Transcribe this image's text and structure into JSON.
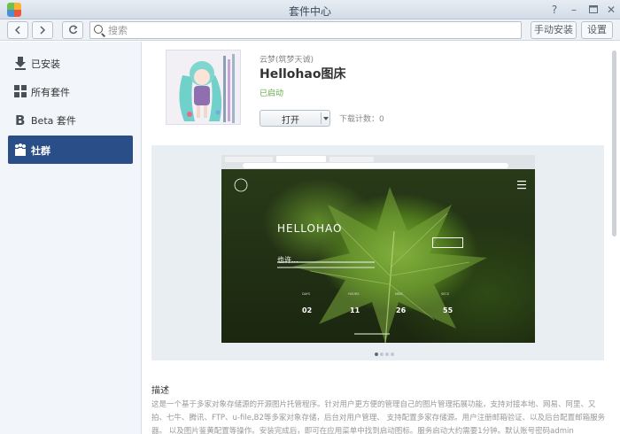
{
  "window": {
    "title": "套件中心"
  },
  "toolbar": {
    "back_icon": "chevron-left-icon",
    "forward_icon": "chevron-right-icon",
    "refresh_icon": "refresh-icon",
    "search_placeholder": "搜索",
    "manual_install_label": "手动安装",
    "settings_label": "设置"
  },
  "sidebar": {
    "items": [
      {
        "label": "已安装",
        "icon": "download-icon",
        "active": false
      },
      {
        "label": "所有套件",
        "icon": "grid-icon",
        "active": false
      },
      {
        "label": "Beta 套件",
        "icon": "beta-icon",
        "active": false
      },
      {
        "label": "社群",
        "icon": "community-icon",
        "active": true
      }
    ]
  },
  "package": {
    "author": "云梦(筑梦天诚)",
    "name": "Hellohao图床",
    "status": "已启动",
    "open_label": "打开",
    "download_count": "下载计数：0",
    "status_color": "#6aa84f"
  },
  "preview": {
    "hero_title": "HELLOHAO",
    "hero_subtitle": "也许...",
    "countdown": [
      {
        "label": "DAYS",
        "value": "02"
      },
      {
        "label": "HOURS",
        "value": "11"
      },
      {
        "label": "MINS",
        "value": "26"
      },
      {
        "label": "SECS",
        "value": "55"
      }
    ]
  },
  "description": {
    "title": "描述",
    "text": "这是一个基于多家对象存储源的开源图片托管程序。针对用户更方便的管理自己的图片管理拓展功能，支持对接本地、网易、阿里、又拍、七牛、腾讯、FTP、u-file,B2等多家对象存储，后台对用户管理、 支持配置多家存储源。用户注册邮箱验证、以及后台配置邮箱服务器。 以及图片鉴黄配置等操作。安装完成后，即可在应用菜单中找到启动图标。服务启动大约需要1分钟。默认账号密码admin"
  },
  "colors": {
    "accent": "#2a4f88"
  }
}
